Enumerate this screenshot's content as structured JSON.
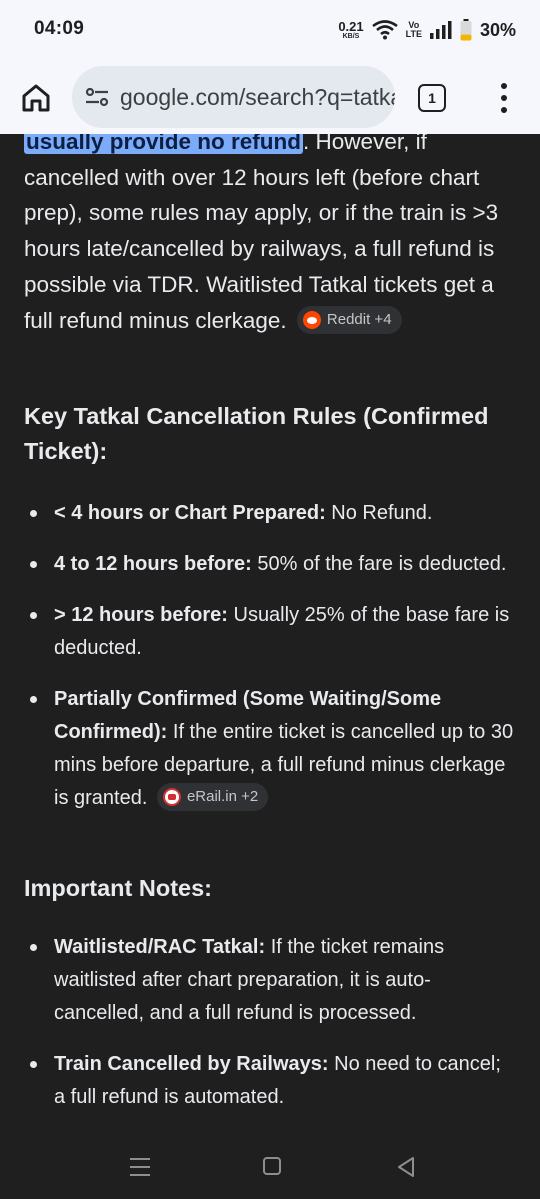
{
  "status_bar": {
    "time": "04:09",
    "net_speed_value": "0.21",
    "net_speed_unit": "KB/S",
    "volte_top": "Vo",
    "volte_bottom": "LTE",
    "battery": "30%",
    "battery_level": 0.3
  },
  "browser": {
    "url": "google.com/search?q=tatkal+ticket+cancellation",
    "tab_count": "1"
  },
  "content": {
    "intro_highlight": "usually provide no refund",
    "intro_rest": ". However, if cancelled with over 12 hours left (before chart prep), some rules may apply, or if the train is >3 hours late/cancelled by railways, a full refund is possible via TDR. Waitlisted Tatkal tickets get a full refund minus clerkage.",
    "intro_chip": "Reddit +4",
    "section1_heading": "Key Tatkal Cancellation Rules (Confirmed Ticket):",
    "rules": [
      {
        "bold": "< 4 hours or Chart Prepared:",
        "text": " No Refund."
      },
      {
        "bold": "4 to 12 hours before:",
        "text": " 50% of the fare is deducted."
      },
      {
        "bold": "> 12 hours before:",
        "text": " Usually 25% of the base fare is deducted."
      },
      {
        "bold": "Partially Confirmed (Some Waiting/Some Confirmed):",
        "text": " If the entire ticket is cancelled up to 30 mins before departure, a full refund minus clerkage is granted.",
        "chip": "eRail.in +2"
      }
    ],
    "section2_heading": "Important Notes:",
    "notes": [
      {
        "bold": "Waitlisted/RAC Tatkal:",
        "text": " If the ticket remains waitlisted after chart preparation, it is auto-cancelled, and a full refund is processed."
      },
      {
        "bold": "Train Cancelled by Railways:",
        "text": " No need to cancel; a full refund is automated."
      }
    ]
  },
  "colors": {
    "background": "#1f1f1f",
    "text": "#e8eaed",
    "highlight": "#7cacf8",
    "chrome_bar": "#f5f7fc"
  },
  "icons": [
    "home-icon",
    "site-settings-icon",
    "tab-switcher-icon",
    "more-menu-icon",
    "wifi-icon",
    "signal-icon",
    "battery-icon",
    "reddit-favicon",
    "erail-favicon",
    "nav-recents-icon",
    "nav-home-icon",
    "nav-back-icon"
  ]
}
